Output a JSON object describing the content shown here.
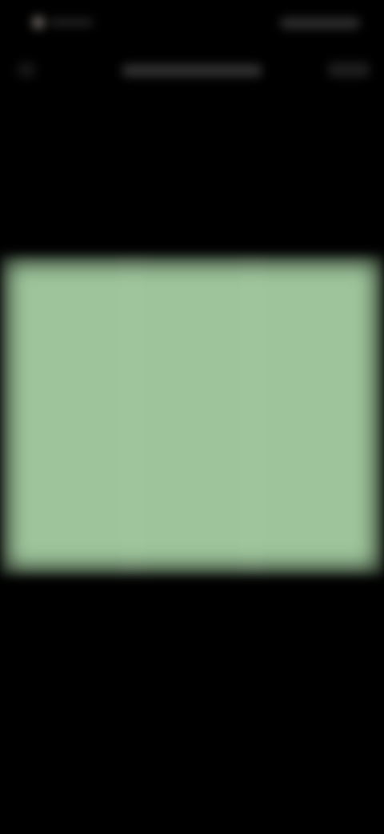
{
  "screen": {
    "background_color": "#000000",
    "content_blurred": true
  },
  "status_bar": {
    "icons": [
      "status-indicator-dot",
      "signal-battery-indicators"
    ]
  },
  "top_bar": {
    "icons": [
      "back-control",
      "action-control"
    ]
  },
  "media_panel": {
    "fill_color": "#9dc49a",
    "description_visible": false
  }
}
